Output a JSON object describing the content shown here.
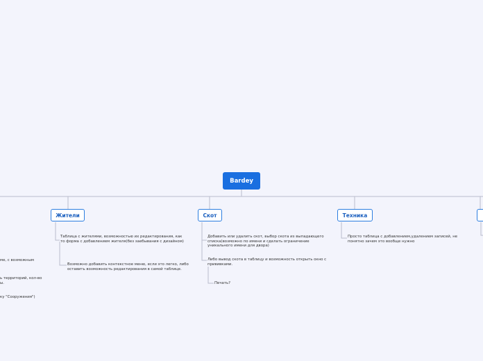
{
  "root": {
    "label": "Bardey"
  },
  "branches": [
    {
      "label": "Жители"
    },
    {
      "label": "Скот"
    },
    {
      "label": "Техника"
    },
    {
      "label": ""
    }
  ],
  "notes": {
    "residents_1": "Таблица с жителями, возможностью их редактирования, как то форма с добавлением жителя(без заебывания с дизайном)",
    "residents_2": "Возможно добавить контекстное меню, если это легко, либо оставить возможность редактирования в самой таблице.",
    "cattle_1": "Добавить или удалить скот, выбор скота из выпадающего списка(возможно по имени и сделать ограничение уникального имени для двора)",
    "cattle_2": "Либо вывод скота в таблицу и возможность открыть окно с прививками.",
    "cattle_3": "Печать?",
    "tech_1": "Просто таблица с добавлением,удалением записей, не понятно зачем это вообще нужно",
    "left_1": "ме, с возможным",
    "left_2": "ь территорий, кол-во",
    "left_3": "ы.",
    "left_4": "ку \"Сооружения\")"
  }
}
